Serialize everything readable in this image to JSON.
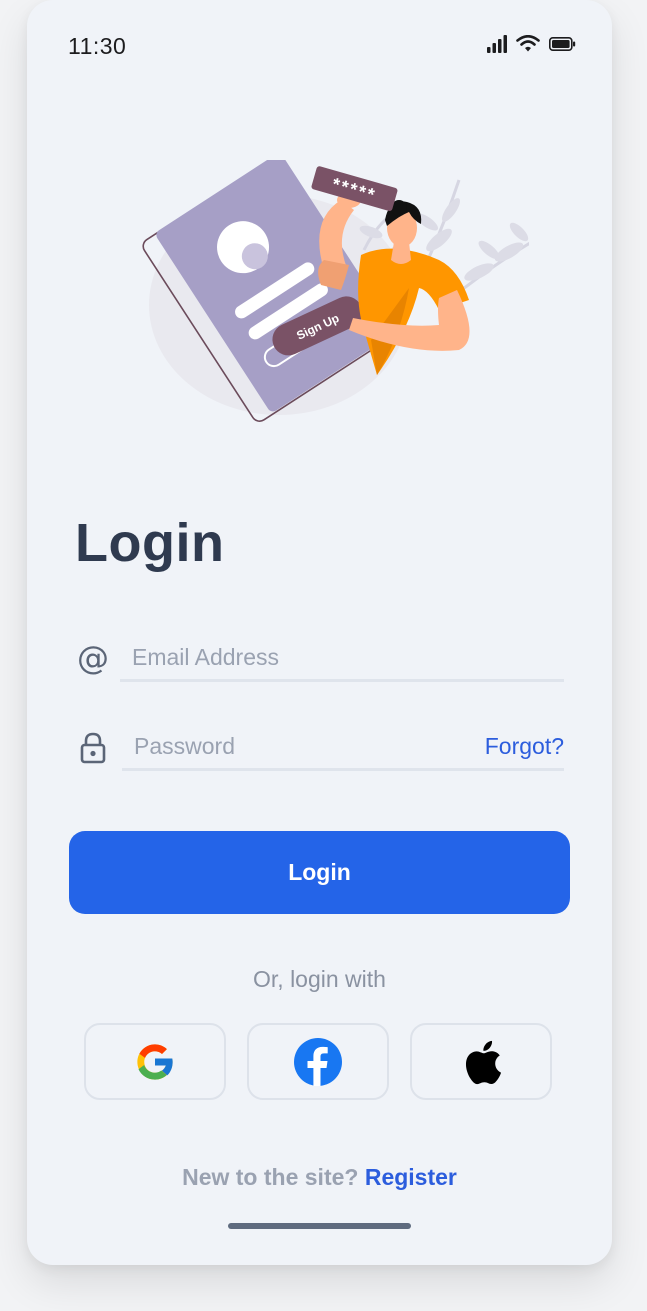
{
  "status_bar": {
    "time": "11:30",
    "icons": [
      "signal-icon",
      "wifi-icon",
      "battery-icon"
    ]
  },
  "illustration": {
    "password_mask": "*****",
    "signup_button_label": "Sign Up"
  },
  "page": {
    "title": "Login"
  },
  "form": {
    "email_icon": "at-icon",
    "email_placeholder": "Email Address",
    "email_value": "",
    "password_icon": "lock-icon",
    "password_placeholder": "Password",
    "password_value": "",
    "forgot_label": "Forgot?",
    "login_button_label": "Login"
  },
  "social": {
    "divider_text": "Or, login with",
    "providers": [
      "google-icon",
      "facebook-icon",
      "apple-icon"
    ]
  },
  "footer": {
    "prompt": "New to the site?",
    "register_label": "Register"
  },
  "colors": {
    "accent": "#2464e8",
    "title": "#2f3a4f",
    "muted": "#9aa2b1",
    "background": "#f0f3f8",
    "illustration_orange": "#ff9600",
    "illustration_purple": "#a69fc6",
    "illustration_mauve": "#7a5266"
  }
}
